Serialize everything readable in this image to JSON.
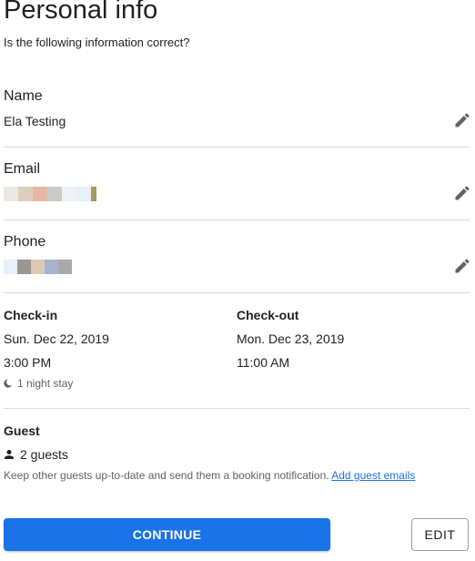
{
  "header": {
    "title": "Personal info",
    "subtitle": "Is the following information correct?"
  },
  "fields": {
    "name": {
      "label": "Name",
      "value": "Ela Testing"
    },
    "email": {
      "label": "Email"
    },
    "phone": {
      "label": "Phone"
    }
  },
  "stay": {
    "checkin": {
      "label": "Check-in",
      "date": "Sun. Dec 22, 2019",
      "time": "3:00 PM"
    },
    "checkout": {
      "label": "Check-out",
      "date": "Mon. Dec 23, 2019",
      "time": "11:00 AM"
    },
    "duration": "1 night stay"
  },
  "guest": {
    "label": "Guest",
    "count": "2 guests",
    "note": "Keep other guests up-to-date and send them a booking notification.",
    "link": "Add guest emails"
  },
  "actions": {
    "continue_label": "CONTINUE",
    "edit_label": "EDIT"
  },
  "colors": {
    "primary": "#1a73e8",
    "text": "#202124",
    "secondary_text": "#5f6368",
    "divider": "#dadce0",
    "pencil": "#5f6368"
  },
  "icons": {
    "edit": "pencil-icon",
    "night": "moon-icon",
    "guest": "person-icon"
  }
}
